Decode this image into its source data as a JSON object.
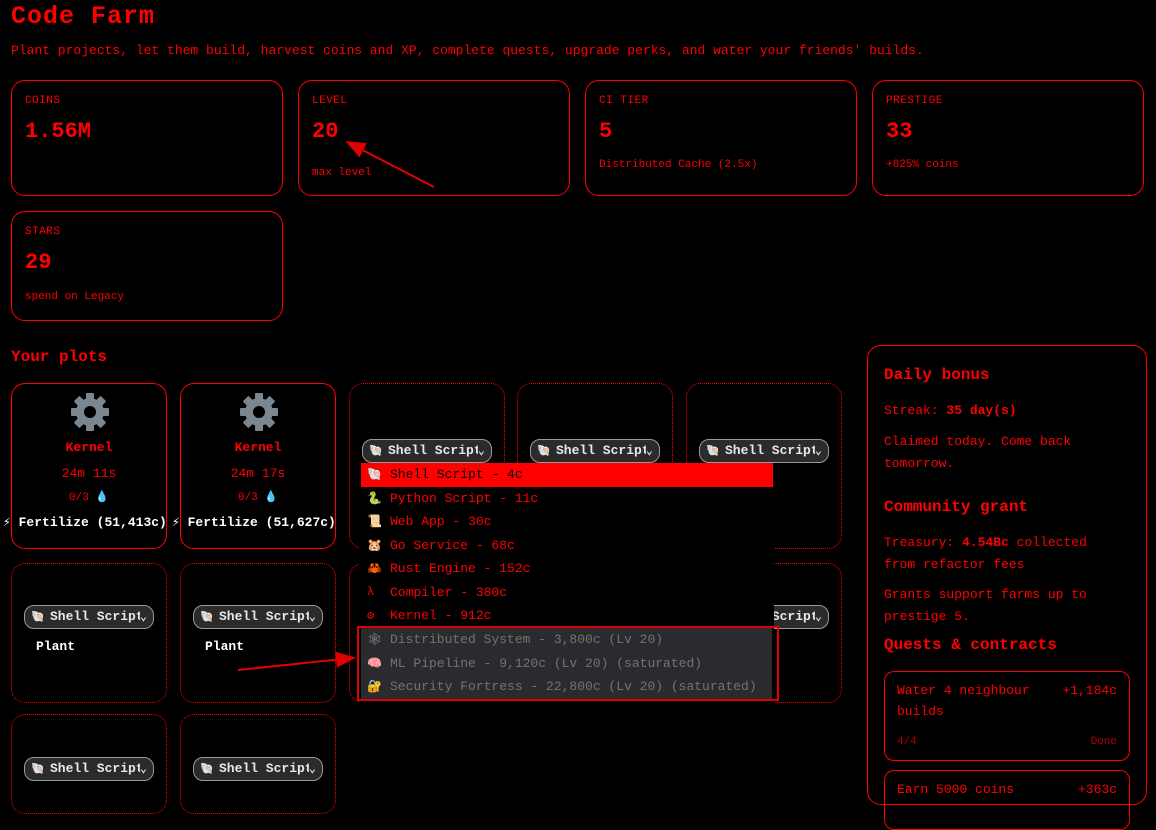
{
  "header": {
    "title": "Code Farm",
    "subtitle": "Plant projects, let them build, harvest coins and XP, complete quests, upgrade perks, and water your friends' builds."
  },
  "stats": {
    "coins": {
      "label": "COINS",
      "value": "1.56M",
      "note": ""
    },
    "level": {
      "label": "LEVEL",
      "value": "20",
      "note": "max level"
    },
    "ci_tier": {
      "label": "CI TIER",
      "value": "5",
      "note": "Distributed Cache (2.5x)"
    },
    "prestige": {
      "label": "PRESTIGE",
      "value": "33",
      "note": "+825% coins"
    },
    "stars": {
      "label": "STARS",
      "value": "29",
      "note": "spend on Legacy"
    }
  },
  "plots_heading": "Your plots",
  "plots": [
    {
      "crop": "Kernel",
      "timer": "24m 11s",
      "water": "0/3 💧",
      "fertilize": "⚡ Fertilize (51,413c)"
    },
    {
      "crop": "Kernel",
      "timer": "24m 17s",
      "water": "0/3 💧",
      "fertilize": "⚡ Fertilize (51,627c)"
    }
  ],
  "select_value": "Shell Script",
  "plant_label": "Plant",
  "dropdown_options": [
    {
      "icon": "🐚",
      "label": "Shell Script - 4c",
      "state": "selected"
    },
    {
      "icon": "🐍",
      "label": "Python Script - 11c",
      "state": "enabled"
    },
    {
      "icon": "📜",
      "label": "Web App - 30c",
      "state": "enabled"
    },
    {
      "icon": "🐹",
      "label": "Go Service - 68c",
      "state": "enabled"
    },
    {
      "icon": "🦀",
      "label": "Rust Engine - 152c",
      "state": "enabled"
    },
    {
      "icon": "λ",
      "label": "Compiler - 380c",
      "state": "enabled"
    },
    {
      "icon": "⚙",
      "label": "Kernel - 912c",
      "state": "enabled"
    },
    {
      "icon": "🕸",
      "label": "Distributed System - 3,800c (Lv 20)",
      "state": "disabled"
    },
    {
      "icon": "🧠",
      "label": "ML Pipeline - 9,120c (Lv 20) (saturated)",
      "state": "disabled"
    },
    {
      "icon": "🔐",
      "label": "Security Fortress - 22,800c (Lv 20) (saturated)",
      "state": "disabled"
    }
  ],
  "sidebar": {
    "daily_heading": "Daily bonus",
    "streak_label": "Streak:",
    "streak_value": "35 day(s)",
    "claimed_text": "Claimed today. Come back tomorrow.",
    "grant_heading": "Community grant",
    "treasury_label": "Treasury:",
    "treasury_value": "4.54Bc",
    "treasury_suffix": "collected from refactor fees",
    "grant_note": "Grants support farms up to prestige 5.",
    "quests_heading": "Quests & contracts",
    "quests": [
      {
        "title": "Water 4 neighbour builds",
        "reward": "+1,184c",
        "progress": "4/4",
        "status": "Done"
      },
      {
        "title": "Earn 5000 coins",
        "reward": "+363c",
        "progress": "",
        "status": ""
      }
    ]
  },
  "colors": {
    "accent": "#ff0000",
    "background": "#000000",
    "select_bg": "#2b2b2b",
    "disabled_bg": "#2b2b2f"
  }
}
